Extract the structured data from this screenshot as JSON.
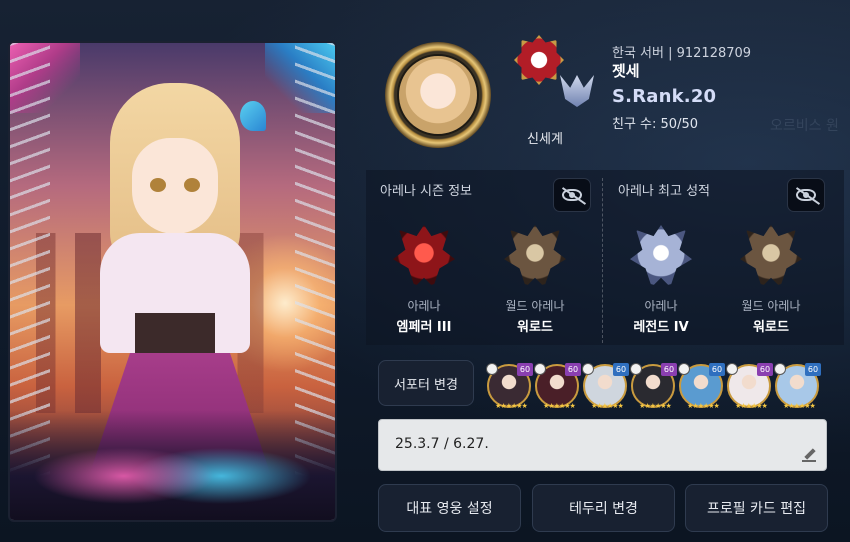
{
  "profile": {
    "server": "한국 서버 | 912128709",
    "name": "젯세",
    "rank": "S.Rank.20",
    "friends": "친구 수: 50/50",
    "world": "신세계"
  },
  "arena_season": {
    "title": "아레나 시즌 정보",
    "tiers": [
      {
        "category": "아레나",
        "value": "엠페러 III",
        "badge": "emperor-badge-icon"
      },
      {
        "category": "월드 아레나",
        "value": "워로드",
        "badge": "warlord-badge-icon"
      }
    ]
  },
  "arena_best": {
    "title": "아레나 최고 성적",
    "tiers": [
      {
        "category": "아레나",
        "value": "레전드 IV",
        "badge": "legend-badge-icon"
      },
      {
        "category": "월드 아레나",
        "value": "워로드",
        "badge": "warlord-badge-icon"
      }
    ]
  },
  "supporter": {
    "button_label": "서포터 변경",
    "heroes": [
      {
        "level": "60",
        "level_color": "#8a3fb0",
        "avatar_color": "#3a2a33",
        "class_icon": "crown-icon"
      },
      {
        "level": "60",
        "level_color": "#8a3fb0",
        "avatar_color": "#4a1f28",
        "class_icon": "sword-icon"
      },
      {
        "level": "60",
        "level_color": "#2f6fbf",
        "avatar_color": "#cfd6de",
        "class_icon": "shield-icon"
      },
      {
        "level": "60",
        "level_color": "#8a3fb0",
        "avatar_color": "#2a2a30",
        "class_icon": "helm-icon"
      },
      {
        "level": "60",
        "level_color": "#2f6fbf",
        "avatar_color": "#5a9bd0",
        "class_icon": "gem-icon"
      },
      {
        "level": "60",
        "level_color": "#8a3fb0",
        "avatar_color": "#efe8ea",
        "class_icon": "skull-icon"
      },
      {
        "level": "60",
        "level_color": "#2f6fbf",
        "avatar_color": "#a8c8e8",
        "class_icon": "wing-icon"
      }
    ]
  },
  "message": {
    "text": "25.3.7 / 6.27."
  },
  "buttons": {
    "representative_hero": "대표 영웅 설정",
    "change_border": "테두리 변경",
    "edit_profile_card": "프로필 카드 편집"
  }
}
